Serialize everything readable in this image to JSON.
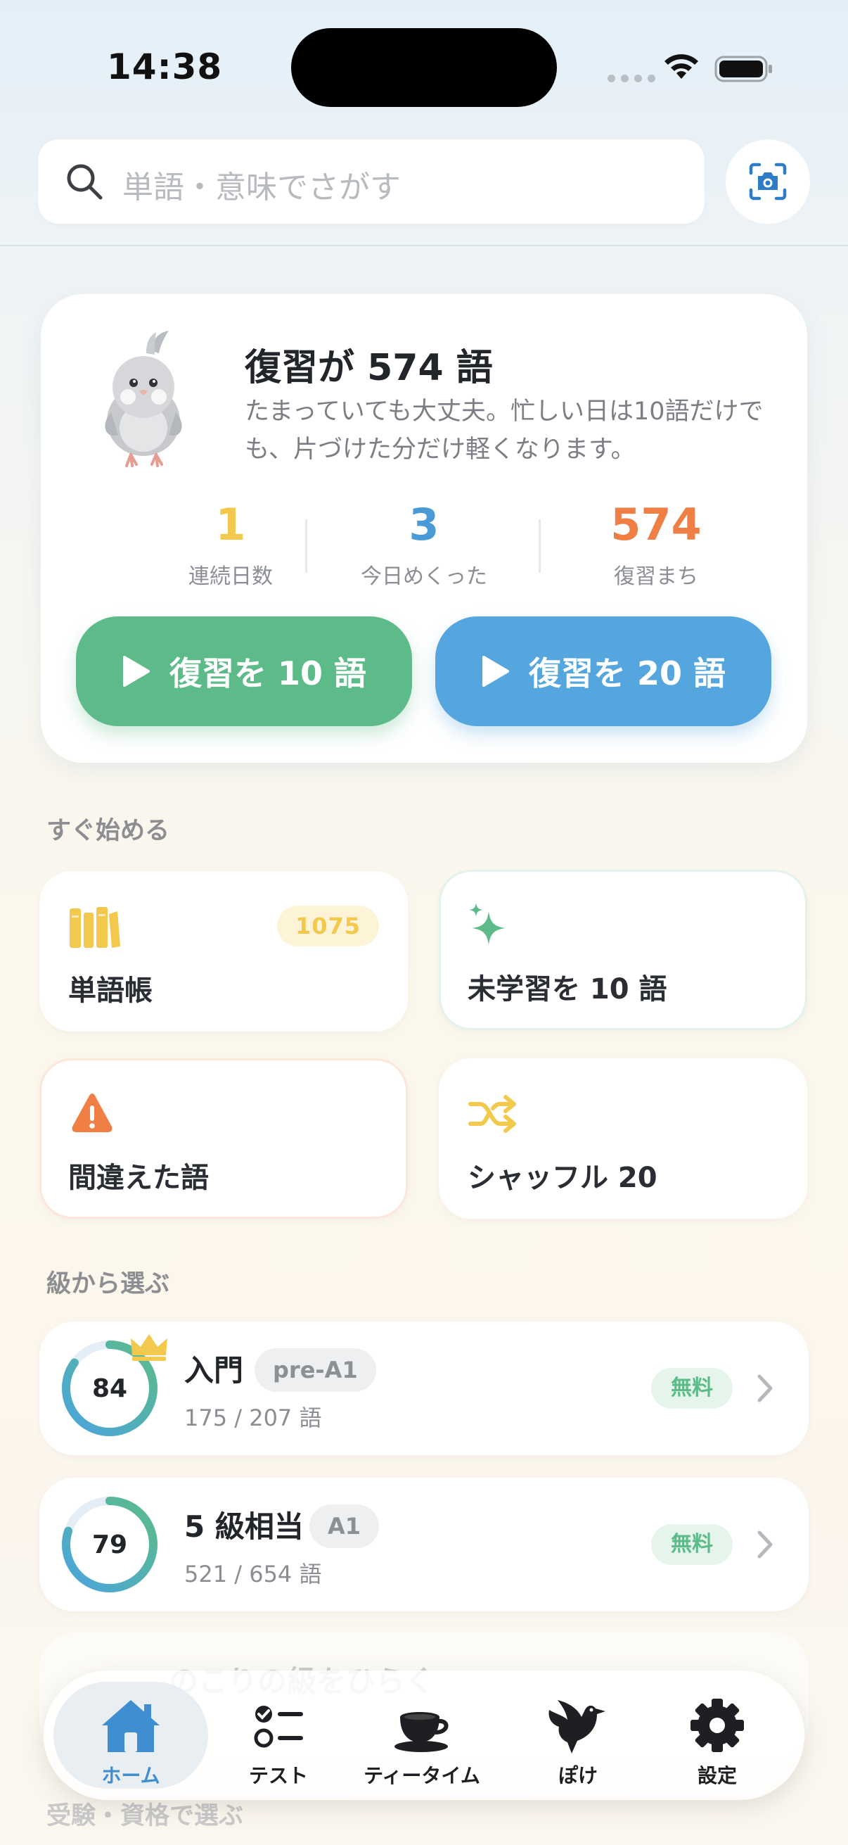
{
  "status_bar": {
    "time": "14:38"
  },
  "search": {
    "placeholder": "単語・意味でさがす"
  },
  "review": {
    "title": "復習が 574 語",
    "description": "たまっていても大丈夫。忙しい日は10語だけでも、片づけた分だけ軽くなります。",
    "stats": [
      {
        "value": "1",
        "label": "連続日数",
        "color": "#f2c94c"
      },
      {
        "value": "3",
        "label": "今日めくった",
        "color": "#4a9ad8"
      },
      {
        "value": "574",
        "label": "復習まち",
        "color": "#ef7f45"
      }
    ],
    "buttons": [
      {
        "label": "復習を 10 語",
        "color": "#5cbb88"
      },
      {
        "label": "復習を 20 語",
        "color": "#55a6df"
      }
    ]
  },
  "quick_start": {
    "header": "すぐ始める",
    "tiles": [
      {
        "label": "単語帳",
        "badge": "1075",
        "icon": "books-icon"
      },
      {
        "label": "未学習を 10 語",
        "icon": "sparkle-icon"
      },
      {
        "label": "間違えた語",
        "icon": "warning-icon"
      },
      {
        "label": "シャッフル 20",
        "icon": "shuffle-icon"
      }
    ]
  },
  "levels": {
    "header": "級から選ぶ",
    "items": [
      {
        "score": "84",
        "progress": 0.85,
        "name": "入門",
        "chip": "pre-A1",
        "count": "175 / 207 語",
        "badge": "無料",
        "crown": true
      },
      {
        "score": "79",
        "progress": 0.8,
        "name": "5 級相当",
        "chip": "A1",
        "count": "521 / 654 語",
        "badge": "無料",
        "crown": false
      }
    ],
    "ghost_title": "のこりの級をひらく"
  },
  "exam_header": "受験・資格で選ぶ",
  "tabs": [
    {
      "label": "ホーム",
      "icon": "home-icon",
      "active": true
    },
    {
      "label": "テスト",
      "icon": "checklist-icon",
      "active": false
    },
    {
      "label": "ティータイム",
      "icon": "teacup-icon",
      "active": false
    },
    {
      "label": "ぽけ",
      "icon": "bird-icon",
      "active": false
    },
    {
      "label": "設定",
      "icon": "gear-icon",
      "active": false
    }
  ]
}
